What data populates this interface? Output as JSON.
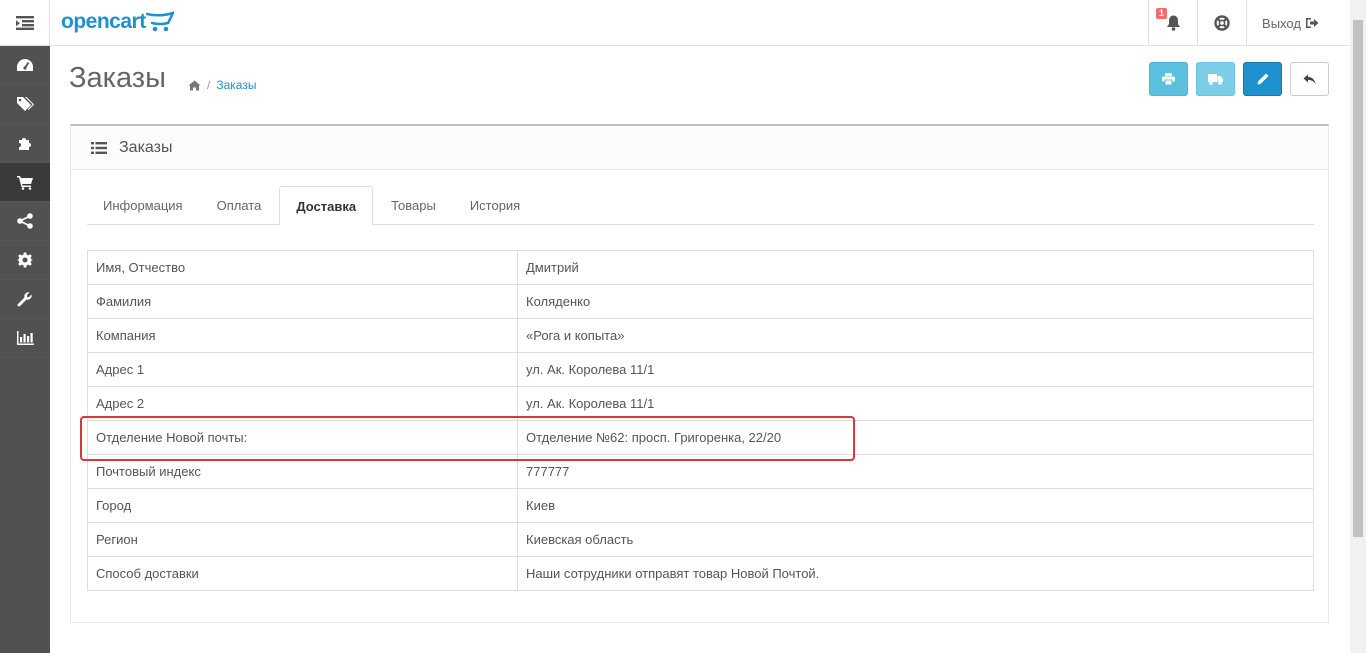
{
  "header": {
    "logo": "opencart",
    "notifications_count": "1",
    "logout_label": "Выход"
  },
  "sidebar": {
    "items": [
      {
        "icon": "dashboard-icon"
      },
      {
        "icon": "tags-icon"
      },
      {
        "icon": "puzzle-icon"
      },
      {
        "icon": "cart-icon",
        "active": true
      },
      {
        "icon": "share-icon"
      },
      {
        "icon": "gear-icon"
      },
      {
        "icon": "wrench-icon"
      },
      {
        "icon": "bar-chart-icon"
      }
    ]
  },
  "page": {
    "title": "Заказы",
    "breadcrumb": {
      "current": "Заказы"
    }
  },
  "panel": {
    "title": "Заказы"
  },
  "tabs": [
    {
      "label": "Информация"
    },
    {
      "label": "Оплата"
    },
    {
      "label": "Доставка",
      "active": true
    },
    {
      "label": "Товары"
    },
    {
      "label": "История"
    }
  ],
  "shipping": [
    {
      "label": "Имя, Отчество",
      "value": "Дмитрий"
    },
    {
      "label": "Фамилия",
      "value": "Коляденко"
    },
    {
      "label": "Компания",
      "value": "«Рога и копыта»"
    },
    {
      "label": "Адрес 1",
      "value": "ул. Ак. Королева 11/1"
    },
    {
      "label": "Адрес 2",
      "value": "ул. Ак. Королева 11/1"
    },
    {
      "label": "Отделение Новой почты:",
      "value": "Отделение №62: просп. Григоренка, 22/20"
    },
    {
      "label": "Почтовый индекс",
      "value": "777777"
    },
    {
      "label": "Город",
      "value": "Киев"
    },
    {
      "label": "Регион",
      "value": "Киевская область"
    },
    {
      "label": "Способ доставки",
      "value": "Наши сотрудники отправят товар Новой Почтой."
    }
  ],
  "colors": {
    "brand": "#1e91cf",
    "sidebar": "#515151",
    "highlight": "#d9363e"
  }
}
